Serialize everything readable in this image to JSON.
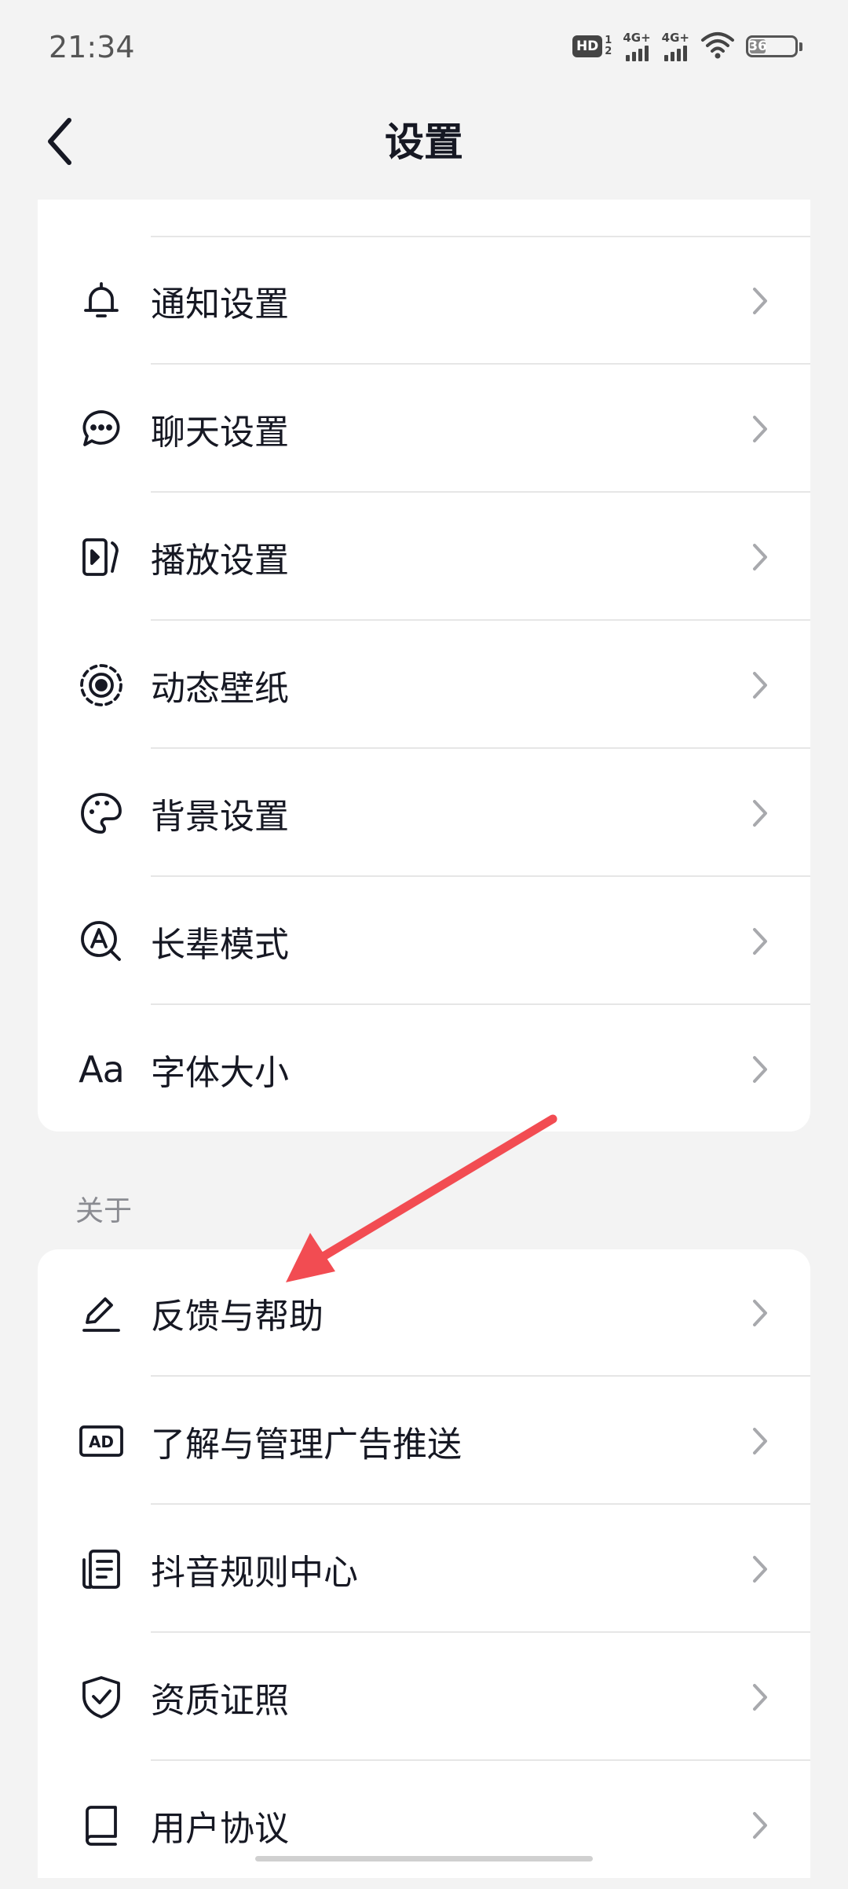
{
  "status_bar": {
    "time": "21:34",
    "hd_label": "HD",
    "hd_sims": [
      "1",
      "2"
    ],
    "signal_1_label": "4G+",
    "signal_2_label": "4G+",
    "battery_level": "36"
  },
  "header": {
    "title": "设置"
  },
  "general_section": {
    "items": [
      {
        "label": "通知设置",
        "icon": "bell-icon"
      },
      {
        "label": "聊天设置",
        "icon": "chat-bubble-icon"
      },
      {
        "label": "播放设置",
        "icon": "play-settings-icon"
      },
      {
        "label": "动态壁纸",
        "icon": "live-wallpaper-icon"
      },
      {
        "label": "背景设置",
        "icon": "palette-icon"
      },
      {
        "label": "长辈模式",
        "icon": "elder-mode-icon"
      },
      {
        "label": "字体大小",
        "icon": "font-size-icon",
        "icon_text": "Aa"
      }
    ]
  },
  "about_section": {
    "title": "关于",
    "items": [
      {
        "label": "反馈与帮助",
        "icon": "edit-pen-icon"
      },
      {
        "label": "了解与管理广告推送",
        "icon": "ad-icon",
        "icon_text": "AD"
      },
      {
        "label": "抖音规则中心",
        "icon": "rules-document-icon"
      },
      {
        "label": "资质证照",
        "icon": "shield-check-icon"
      },
      {
        "label": "用户协议",
        "icon": "book-icon"
      }
    ]
  },
  "colors": {
    "background": "#f3f3f3",
    "card": "#ffffff",
    "text_primary": "#161823",
    "text_secondary": "#8a8b91",
    "chevron": "#a8a9ad",
    "annotation_arrow": "#f24c52"
  }
}
